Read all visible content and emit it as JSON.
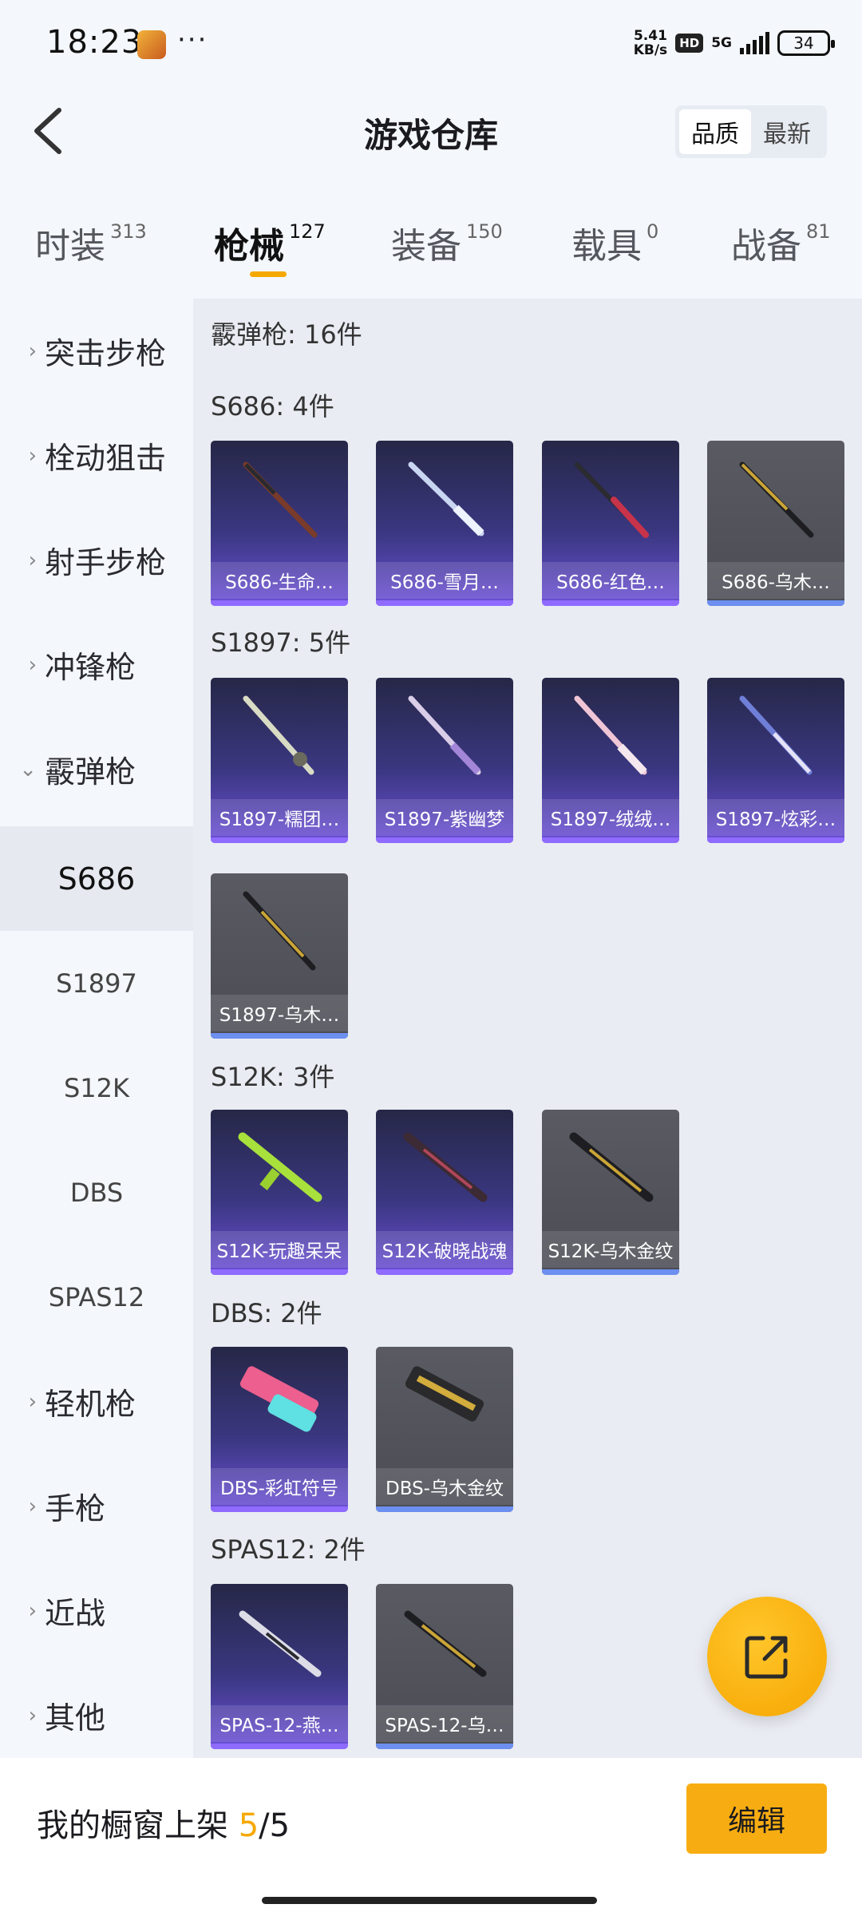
{
  "status_bar": {
    "time": "18:23",
    "dots": "···",
    "speed_value": "5.41",
    "speed_unit": "KB/s",
    "hd": "HD",
    "network": "5G",
    "battery": "34"
  },
  "header": {
    "title": "游戏仓库",
    "sort": [
      {
        "label": "品质",
        "active": true
      },
      {
        "label": "最新",
        "active": false
      }
    ]
  },
  "tabs": [
    {
      "label": "时装",
      "count": "313"
    },
    {
      "label": "枪械",
      "count": "127",
      "active": true
    },
    {
      "label": "装备",
      "count": "150"
    },
    {
      "label": "载具",
      "count": "0"
    },
    {
      "label": "战备",
      "count": "81"
    }
  ],
  "sidebar": {
    "categories": [
      "突击步枪",
      "栓动狙击",
      "射手步枪",
      "冲锋枪",
      "霰弹枪",
      "轻机枪",
      "手枪",
      "近战",
      "其他"
    ],
    "subcategories": [
      "S686",
      "S1897",
      "S12K",
      "DBS",
      "SPAS12"
    ],
    "active_sub": "S686"
  },
  "main": {
    "summary": "霰弹枪: 16件",
    "groups": [
      {
        "title": "S686: 4件",
        "items": [
          "S686-生命…",
          "S686-雪月…",
          "S686-红色…",
          "S686-乌木…"
        ]
      },
      {
        "title": "S1897: 5件",
        "items": [
          "S1897-糯团…",
          "S1897-紫幽梦",
          "S1897-绒绒…",
          "S1897-炫彩…",
          "S1897-乌木…"
        ]
      },
      {
        "title": "S12K: 3件",
        "items": [
          "S12K-玩趣呆呆",
          "S12K-破晓战魂",
          "S12K-乌木金纹"
        ]
      },
      {
        "title": "DBS: 2件",
        "items": [
          "DBS-彩虹符号",
          "DBS-乌木金纹"
        ]
      },
      {
        "title": "SPAS12: 2件",
        "items": [
          "SPAS-12-燕…",
          "SPAS-12-乌…"
        ]
      }
    ]
  },
  "icons": {
    "back": "back-chevron-icon",
    "share": "share-external-icon",
    "chevron": "chevron-right-icon"
  },
  "colors": {
    "accent": "#f5a800",
    "purple_tier": "#6c4fd8",
    "gray_tier": "#4b4c54"
  },
  "bottom_bar": {
    "label": "我的橱窗上架",
    "current": "5",
    "separator": "/",
    "total": "5",
    "edit": "编辑"
  }
}
